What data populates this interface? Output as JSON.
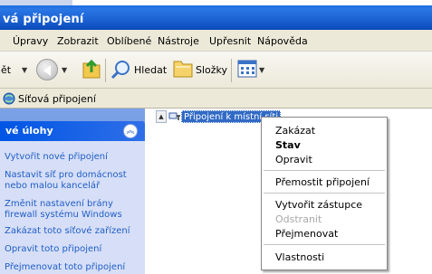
{
  "window": {
    "title": "vá připojení"
  },
  "menubar": {
    "items": [
      "Úpravy",
      "Zobrazit",
      "Oblíbené",
      "Nástroje",
      "Upřesnit",
      "Nápověda"
    ]
  },
  "toolbar": {
    "back_label": "ět",
    "search_label": "Hledat",
    "folders_label": "Složky"
  },
  "address": {
    "label": "Síťová připojení"
  },
  "tasks": {
    "title": "vé úlohy",
    "links": [
      "Vytvořit nové připojení",
      "Nastavit síť pro domácnost",
      "nebo malou kancelář",
      "Změnit nastavení brány",
      "firewall systému Windows",
      "Zakázat toto síťové zařízení",
      "Opravit toto připojení",
      "Přejmenovat toto připojení"
    ]
  },
  "connection": {
    "label": "Připojení k místní síti"
  },
  "context_menu": {
    "items": [
      {
        "label": "Zakázat",
        "state": "normal"
      },
      {
        "label": "Stav",
        "state": "default"
      },
      {
        "label": "Opravit",
        "state": "normal"
      },
      {
        "label": "Přemostit připojení",
        "state": "normal"
      },
      {
        "label": "Vytvořit zástupce",
        "state": "normal"
      },
      {
        "label": "Odstranit",
        "state": "disabled"
      },
      {
        "label": "Přejmenovat",
        "state": "normal"
      },
      {
        "label": "Vlastnosti",
        "state": "normal"
      }
    ]
  },
  "colors": {
    "titlebar": "#0a5fd8",
    "selection": "#316ac5",
    "task_link": "#215dc6"
  }
}
